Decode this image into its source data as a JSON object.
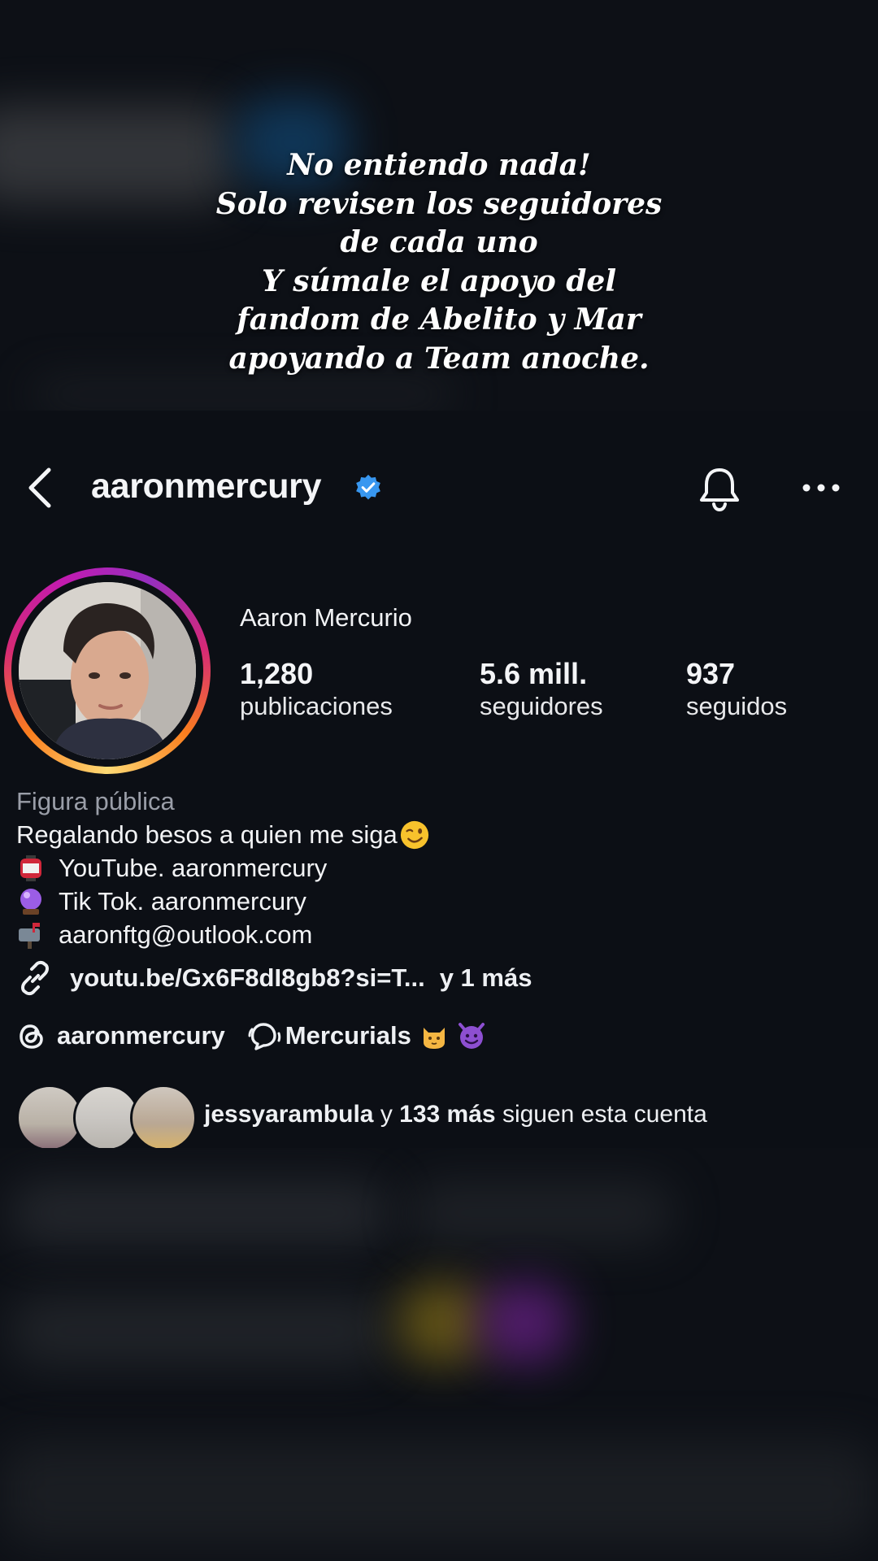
{
  "overlay_caption": {
    "lines": [
      "No entiendo nada!",
      "Solo revisen los seguidores",
      "de cada uno",
      "Y súmale el apoyo del",
      "fandom de Abelito y Mar",
      "apoyando a Team anoche."
    ]
  },
  "header": {
    "username": "aaronmercury",
    "verified": true,
    "icons": [
      "back-icon",
      "verified-badge-icon",
      "bell-icon",
      "more-icon"
    ]
  },
  "profile": {
    "display_name": "Aaron Mercurio",
    "stats": {
      "posts_count": "1,280",
      "posts_label": "publicaciones",
      "followers_count": "5.6 mill.",
      "followers_label": "seguidores",
      "following_count": "937",
      "following_label": "seguidos"
    },
    "category": "Figura pública",
    "bio": {
      "line1": "Regalando besos a quien me siga",
      "line1_emoji": "winking-face",
      "line2_emoji": "red-paper-lantern",
      "line2": "YouTube. aaronmercury",
      "line3_emoji": "crystal-ball",
      "line3": "Tik Tok. aaronmercury",
      "line4_emoji": "open-mailbox",
      "line4": "aaronftg@outlook.com"
    },
    "link": {
      "text": "youtu.be/Gx6F8dI8gb8?si=T...",
      "more": "y 1 más"
    },
    "threads": {
      "name": "aaronmercury"
    },
    "channel": {
      "name": "Mercurials",
      "emojis": [
        "cat-face",
        "smiling-imp"
      ]
    },
    "followed_by": {
      "user": "jessyarambula",
      "connector": "y",
      "count": "133 más",
      "suffix": "siguen esta cuenta"
    }
  },
  "colors": {
    "background": "#0c0f15",
    "verified_blue": "#3897f0",
    "story_ring": [
      "#feda75",
      "#fa7e1e",
      "#d62976",
      "#962fbf"
    ]
  }
}
